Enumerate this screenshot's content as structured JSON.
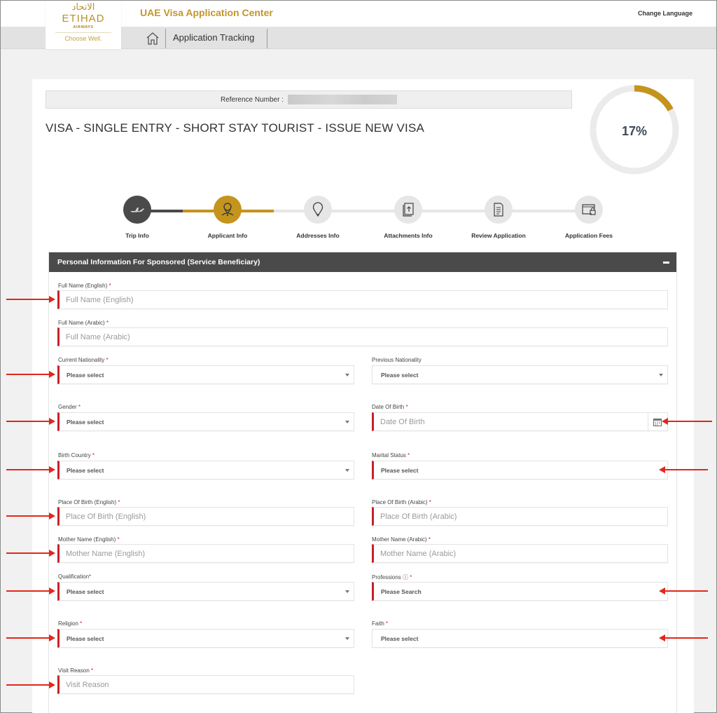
{
  "header": {
    "logo": {
      "arabic": "الاتحاد",
      "name": "ETIHAD",
      "sub": "AIRWAYS",
      "tagline": "Choose Well."
    },
    "app_title": "UAE Visa Application Center",
    "change_language": "Change Language",
    "nav": {
      "home_icon": "home-icon",
      "tracking_label": "Application Tracking"
    }
  },
  "application": {
    "reference_label": "Reference Number :",
    "reference_value_redacted": true,
    "visa_title": "VISA - SINGLE ENTRY - SHORT STAY TOURIST - ISSUE NEW VISA",
    "progress_percent": 17,
    "progress_label": "17%",
    "colors": {
      "accent": "#c4941c",
      "complete": "#4a4a4a",
      "pending": "#e6e6e6",
      "required": "#c8202a",
      "annotation_arrow": "#e3261c"
    }
  },
  "steps": [
    {
      "label": "Trip Info",
      "icon": "airplane-icon",
      "state": "completed"
    },
    {
      "label": "Applicant Info",
      "icon": "user-pin-icon",
      "state": "active"
    },
    {
      "label": "Addresses Info",
      "icon": "location-pin-icon",
      "state": "pending"
    },
    {
      "label": "Attachments Info",
      "icon": "upload-document-icon",
      "state": "pending"
    },
    {
      "label": "Review Application",
      "icon": "document-list-icon",
      "state": "pending"
    },
    {
      "label": "Application Fees",
      "icon": "secure-payment-icon",
      "state": "pending"
    }
  ],
  "panel": {
    "title": "Personal Information For Sponsored (Service Beneficiary)",
    "collapse_icon": "minus-icon"
  },
  "fields": {
    "full_name_en": {
      "label": "Full Name (English)",
      "required": true,
      "placeholder": "Full Name (English)",
      "value": ""
    },
    "full_name_ar": {
      "label": "Full Name (Arabic)",
      "required": true,
      "placeholder": "Full Name (Arabic)",
      "value": ""
    },
    "current_nationality": {
      "label": "Current Nationality",
      "required": true,
      "selected": "Please select"
    },
    "previous_nationality": {
      "label": "Previous Nationality",
      "required": false,
      "selected": "Please select"
    },
    "gender": {
      "label": "Gender",
      "required": true,
      "selected": "Please select"
    },
    "date_of_birth": {
      "label": "Date Of Birth",
      "required": true,
      "placeholder": "Date Of Birth",
      "value": ""
    },
    "birth_country": {
      "label": "Birth Country",
      "required": true,
      "selected": "Please select"
    },
    "marital_status": {
      "label": "Marital Status",
      "required": true,
      "selected": "Please select"
    },
    "place_of_birth_en": {
      "label": "Place Of Birth (English)",
      "required": true,
      "placeholder": "Place Of Birth (English)",
      "value": ""
    },
    "place_of_birth_ar": {
      "label": "Place Of Birth (Arabic)",
      "required": true,
      "placeholder": "Place Of Birth (Arabic)",
      "value": ""
    },
    "mother_name_en": {
      "label": "Mother Name (English)",
      "required": true,
      "placeholder": "Mother Name (English)",
      "value": ""
    },
    "mother_name_ar": {
      "label": "Mother Name (Arabic)",
      "required": true,
      "placeholder": "Mother Name (Arabic)",
      "value": ""
    },
    "qualification": {
      "label": "Qualification",
      "required": true,
      "selected": "Please select"
    },
    "professions": {
      "label": "Professions",
      "info_icon": "info-icon",
      "required": true,
      "selected": "Please Search"
    },
    "religion": {
      "label": "Religion",
      "required": true,
      "selected": "Please select"
    },
    "faith": {
      "label": "Faith",
      "required": true,
      "selected": "Please select"
    },
    "visit_reason": {
      "label": "Visit Reason",
      "required": true,
      "placeholder": "Visit Reason",
      "value": ""
    }
  },
  "labels": {
    "required_marker": " *",
    "required_marker_tight": "*",
    "info_marker": " ⓘ"
  }
}
